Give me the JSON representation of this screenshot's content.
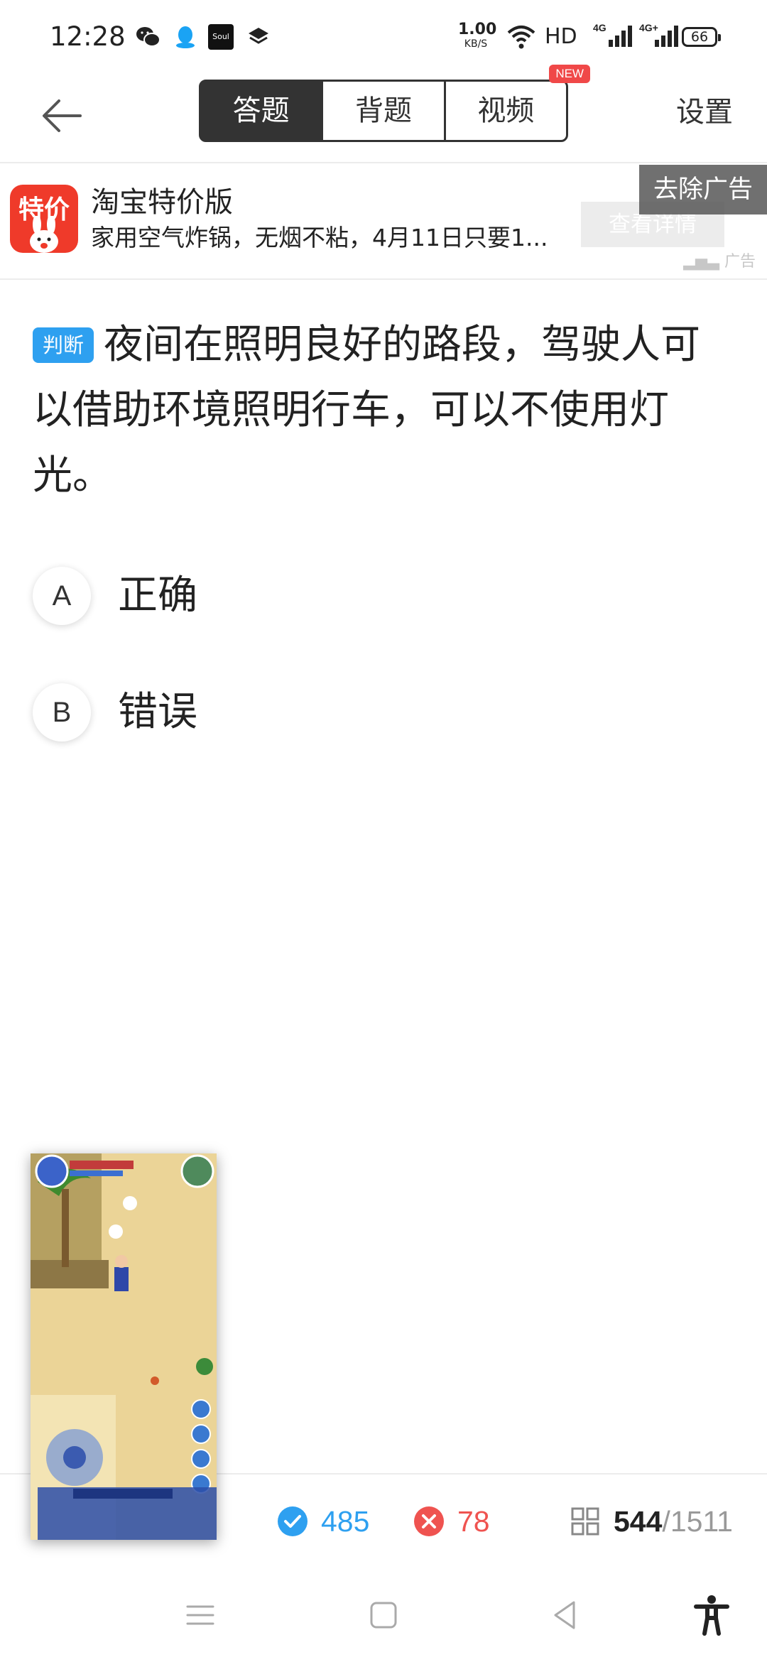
{
  "status_bar": {
    "time": "12:28",
    "net_speed_value": "1.00",
    "net_speed_unit": "KB/S",
    "hd_label": "HD",
    "battery": "66"
  },
  "header": {
    "tabs": [
      {
        "label": "答题",
        "active": true
      },
      {
        "label": "背题",
        "active": false
      },
      {
        "label": "视频",
        "active": false,
        "badge": "NEW"
      }
    ],
    "settings_label": "设置"
  },
  "ad": {
    "logo_text": "特价",
    "title": "淘宝特价版",
    "description": "家用空气炸锅，无烟不粘，4月11日只要1...",
    "remove_label": "去除广告",
    "detail_label": "查看详情",
    "ad_mark": "广告"
  },
  "question": {
    "type_label": "判断",
    "text": "夜间在照明良好的路段，驾驶人可以借助环境照明行车，可以不使用灯光。",
    "options": [
      {
        "letter": "A",
        "label": "正确"
      },
      {
        "letter": "B",
        "label": "错误"
      }
    ]
  },
  "stats": {
    "correct": "485",
    "wrong": "78",
    "current": "544",
    "total": "/1511"
  },
  "colors": {
    "accent_blue": "#2ea0f0",
    "wrong_red": "#ef5350",
    "tab_dark": "#333333",
    "badge_red": "#f04848"
  }
}
